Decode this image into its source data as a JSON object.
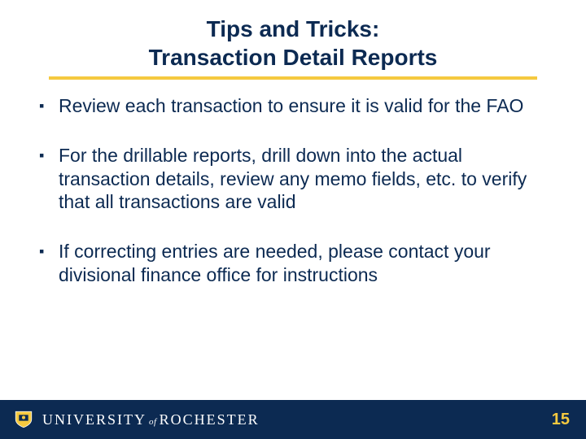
{
  "title": {
    "line1": "Tips and Tricks:",
    "line2": "Transaction Detail Reports"
  },
  "bullets": [
    "Review each transaction to ensure it is valid for the FAO",
    "For the drillable reports, drill down into the actual transaction details, review any memo fields, etc. to verify that all transactions are valid",
    "If correcting entries are needed, please contact your divisional finance office for instructions"
  ],
  "footer": {
    "brand_university": "UNIVERSITY",
    "brand_of": "of",
    "brand_rochester": "ROCHESTER",
    "page_number": "15"
  },
  "colors": {
    "primary": "#0c2a52",
    "accent": "#f5c93f"
  }
}
